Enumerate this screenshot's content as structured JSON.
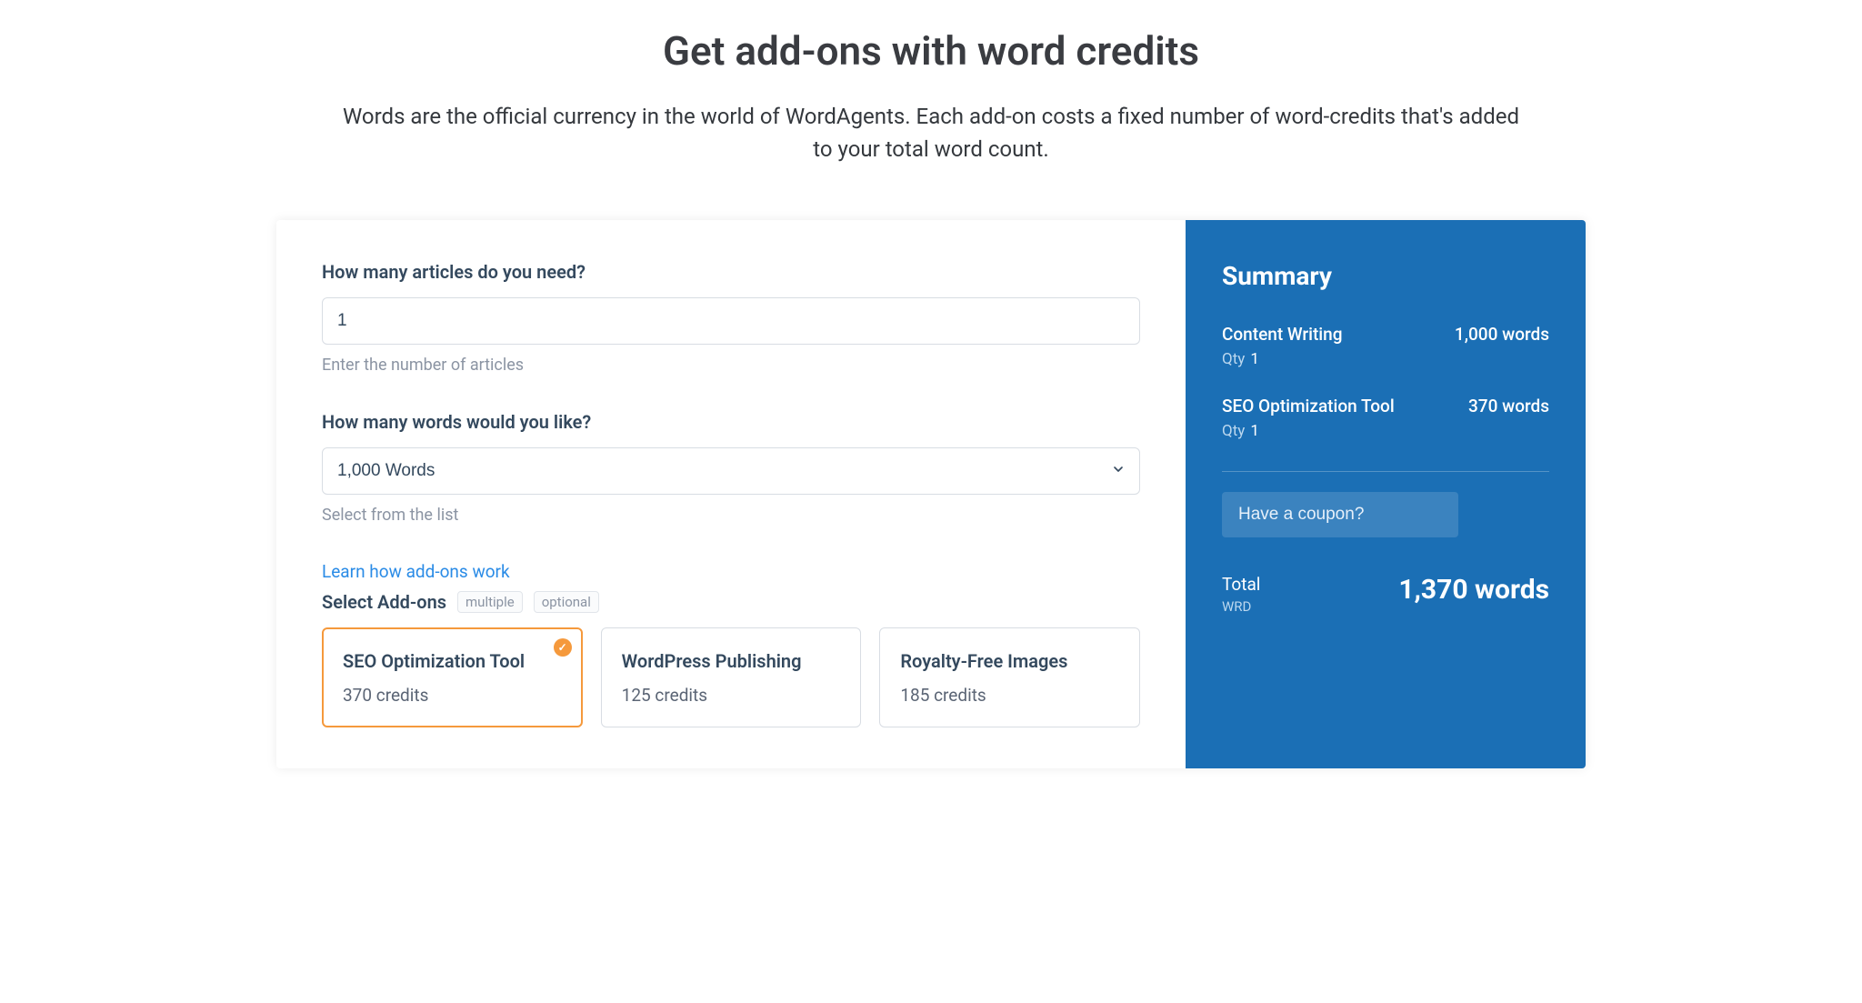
{
  "header": {
    "title": "Get add-ons with word credits",
    "subtitle": "Words are the official currency in the world of WordAgents. Each add-on costs a fixed number of word-credits that's added to your total word count."
  },
  "form": {
    "articles": {
      "label": "How many articles do you need?",
      "value": "1",
      "helper": "Enter the number of articles"
    },
    "words": {
      "label": "How many words would you like?",
      "value": "1,000 Words",
      "helper": "Select from the list"
    },
    "addons": {
      "link": "Learn how add-ons work",
      "title": "Select Add-ons",
      "badges": [
        "multiple",
        "optional"
      ],
      "options": [
        {
          "name": "SEO Optimization Tool",
          "credits": "370 credits",
          "selected": true
        },
        {
          "name": "WordPress Publishing",
          "credits": "125 credits",
          "selected": false
        },
        {
          "name": "Royalty-Free Images",
          "credits": "185 credits",
          "selected": false
        }
      ]
    }
  },
  "summary": {
    "title": "Summary",
    "items": [
      {
        "name": "Content Writing",
        "amount": "1,000 words",
        "qty_label": "Qty",
        "qty": "1"
      },
      {
        "name": "SEO Optimization Tool",
        "amount": "370 words",
        "qty_label": "Qty",
        "qty": "1"
      }
    ],
    "coupon_label": "Have a coupon?",
    "total_label": "Total",
    "total_unit": "WRD",
    "total_value": "1,370 words"
  }
}
